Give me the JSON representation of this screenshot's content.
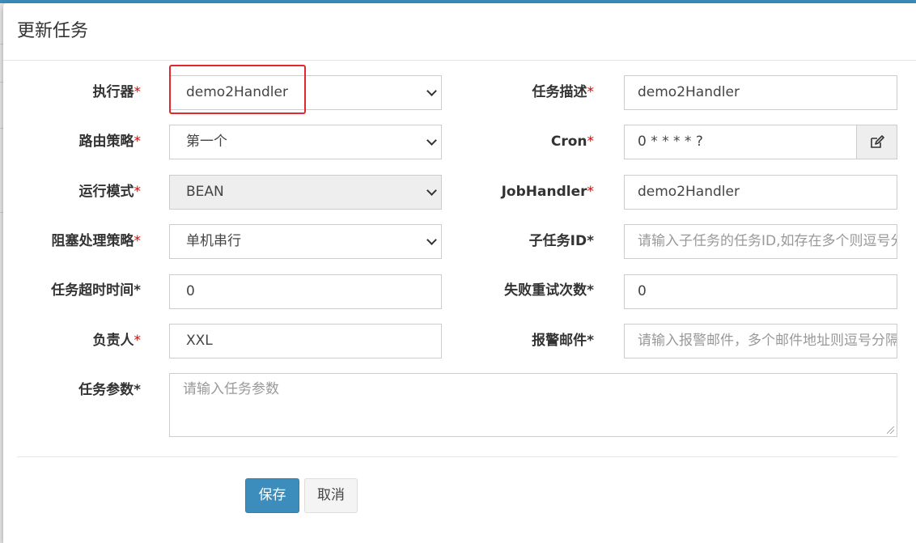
{
  "modal": {
    "title": "更新任务"
  },
  "form": {
    "executor": {
      "label": "执行器",
      "value": "demo2Handler"
    },
    "route_strategy": {
      "label": "路由策略",
      "value": "第一个"
    },
    "run_mode": {
      "label": "运行模式",
      "value": "BEAN"
    },
    "block_strategy": {
      "label": "阻塞处理策略",
      "value": "单机串行"
    },
    "timeout": {
      "label": "任务超时时间",
      "value": "0"
    },
    "owner": {
      "label": "负责人",
      "value": "XXL"
    },
    "job_param": {
      "label": "任务参数",
      "placeholder": "请输入任务参数"
    },
    "job_desc": {
      "label": "任务描述",
      "value": "demo2Handler"
    },
    "cron": {
      "label": "Cron",
      "value": "0 * * * * ?",
      "addon_icon": "edit-icon"
    },
    "job_handler": {
      "label": "JobHandler",
      "value": "demo2Handler"
    },
    "child_job_id": {
      "label": "子任务ID",
      "placeholder": "请输入子任务的任务ID,如存在多个则逗号分隔"
    },
    "fail_retry": {
      "label": "失败重试次数",
      "value": "0"
    },
    "alarm_email": {
      "label": "报警邮件",
      "placeholder": "请输入报警邮件，多个邮件地址则逗号分隔"
    }
  },
  "buttons": {
    "save": "保存",
    "cancel": "取消"
  },
  "colors": {
    "primary": "#3c8dbc",
    "required": "#dd0000",
    "highlight": "#e4262e"
  }
}
